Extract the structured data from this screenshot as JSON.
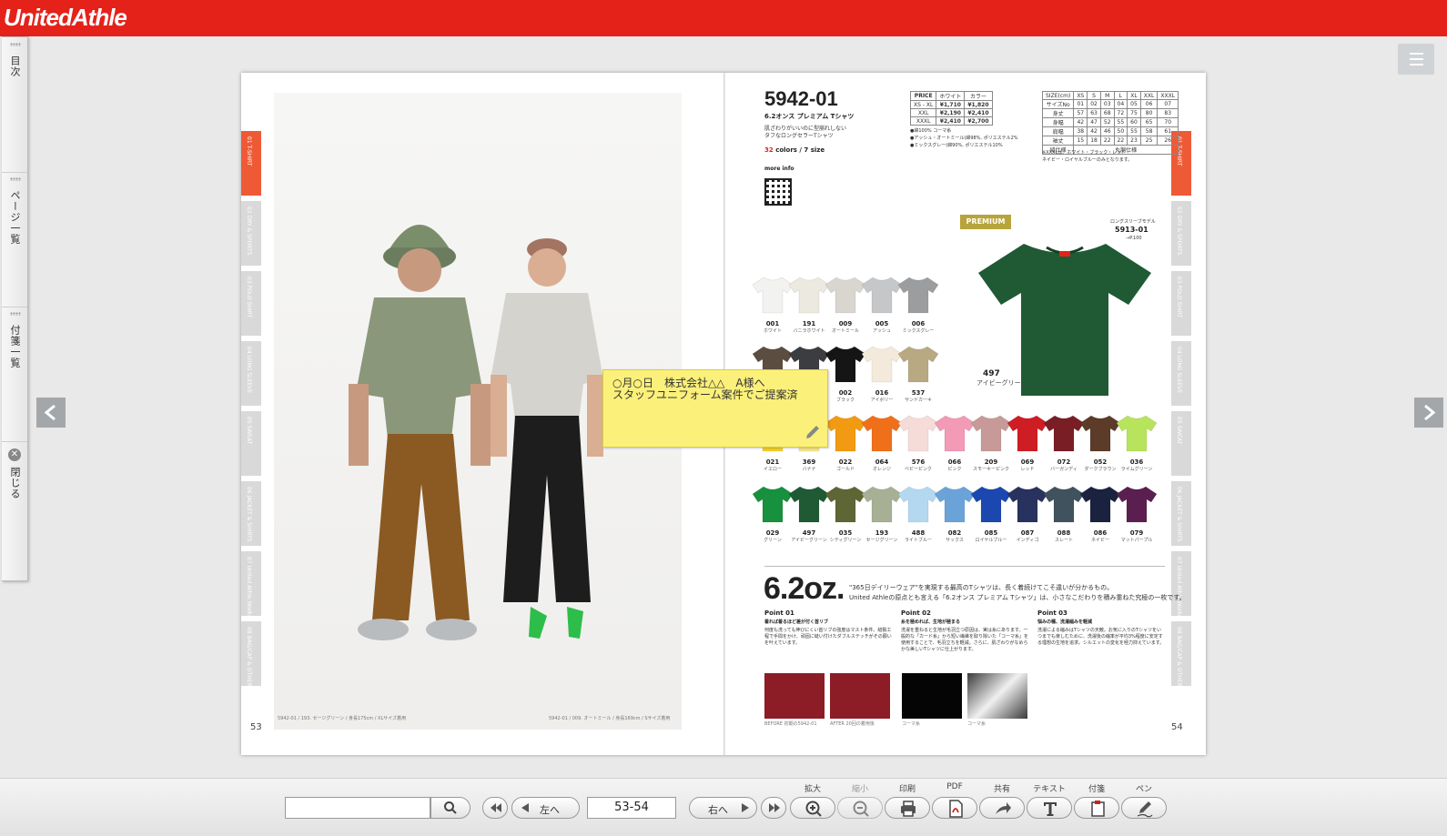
{
  "app": {
    "logo": "UnitedAthle"
  },
  "sidebar": {
    "items": [
      {
        "label": "目次"
      },
      {
        "label": "ページ一覧"
      },
      {
        "label": "付箋一覧"
      },
      {
        "label": "閉じる"
      }
    ]
  },
  "book": {
    "left_page": {
      "number": "53",
      "caption_left": "5942-01 / 193. セージグリーン / 身長175cm / XLサイズ着用",
      "caption_right": "5942-01 / 009. オートミール / 身長169cm / Sサイズ着用",
      "tabs": [
        "01 T-SHIRT",
        "02 DRY & SPORTS",
        "03 POLO SHIRT",
        "04 LONG SLEEVE",
        "05 SWEAT",
        "06 JACKET & SHIRTS",
        "07 United Athle Works",
        "08 BAG/CAP & OTHER"
      ]
    },
    "right_page": {
      "number": "54",
      "product_code": "5942-01",
      "product_name": "6.2オンス プレミアム Tシャツ",
      "desc_1": "肌ざわりがいいのに型崩れしない",
      "desc_2": "タフなロングセラーTシャツ",
      "colors_count": "32",
      "colors_suffix": "colors / 7 size",
      "more_info": "more info",
      "material_1": "●綿100% コーマ糸",
      "material_2": "●アッシュ・オートミール(綿98%, ポリエステル2%",
      "material_3": "●ミックスグレー(綿90%, ポリエステル10%",
      "premium_badge": "PREMIUM",
      "related_label": "ロングスリーブモデル",
      "related_code": "5913-01",
      "related_page": "→P.100",
      "size_note_1": "※XXXLは、ホワイト・ブラック・レッド・",
      "size_note_2": "ネイビー・ロイヤルブルーのみとなります。",
      "featured": {
        "code": "497",
        "name": "アイビーグリーン"
      },
      "price_table": {
        "header": [
          "PRICE",
          "ホワイト",
          "カラー"
        ],
        "rows": [
          [
            "XS - XL",
            "¥1,710",
            "¥1,820"
          ],
          [
            "XXL",
            "¥2,190",
            "¥2,410"
          ],
          [
            "XXXL",
            "¥2,410",
            "¥2,700"
          ]
        ]
      },
      "size_table": {
        "header": [
          "SIZE(cm)",
          "XS",
          "S",
          "M",
          "L",
          "XL",
          "XXL",
          "XXXL"
        ],
        "rows": [
          [
            "サイズNo",
            "01",
            "02",
            "03",
            "04",
            "05",
            "06",
            "07"
          ],
          [
            "身丈",
            "57",
            "63",
            "68",
            "72",
            "75",
            "80",
            "83"
          ],
          [
            "身幅",
            "42",
            "47",
            "52",
            "55",
            "60",
            "65",
            "70"
          ],
          [
            "肩幅",
            "38",
            "42",
            "46",
            "50",
            "55",
            "58",
            "61"
          ],
          [
            "袖丈",
            "15",
            "18",
            "22",
            "22",
            "23",
            "25",
            "26"
          ],
          [
            "縫仕様",
            "",
            "",
            "",
            "丸胴仕様",
            "",
            "",
            ""
          ]
        ]
      },
      "swatches_row1": [
        {
          "code": "001",
          "name": "ホワイト",
          "color": "#f2f2f0"
        },
        {
          "code": "191",
          "name": "バニラホワイト",
          "color": "#ece9e0"
        },
        {
          "code": "009",
          "name": "オートミール",
          "color": "#d9d6cf"
        },
        {
          "code": "005",
          "name": "アッシュ",
          "color": "#c5c7c9"
        },
        {
          "code": "006",
          "name": "ミックスグレー",
          "color": "#9c9d9f"
        }
      ],
      "swatches_row2": [
        {
          "code": "",
          "name": "",
          "color": "#5b4d40"
        },
        {
          "code": "",
          "name": "",
          "color": "#3c3d40"
        },
        {
          "code": "002",
          "name": "ブラック",
          "color": "#151515"
        },
        {
          "code": "016",
          "name": "アイボリー",
          "color": "#f3eadb"
        },
        {
          "code": "537",
          "name": "サンドカーキ",
          "color": "#b9a983"
        }
      ],
      "swatches_row3": [
        {
          "code": "021",
          "name": "イエロー",
          "color": "#f6d02a"
        },
        {
          "code": "369",
          "name": "バナナ",
          "color": "#f8e68c"
        },
        {
          "code": "022",
          "name": "ゴールド",
          "color": "#f29a12"
        },
        {
          "code": "064",
          "name": "オレンジ",
          "color": "#f0701a"
        },
        {
          "code": "576",
          "name": "ベビーピンク",
          "color": "#f5dcd9"
        },
        {
          "code": "066",
          "name": "ピンク",
          "color": "#f29ab6"
        },
        {
          "code": "209",
          "name": "スモーキーピンク",
          "color": "#c79a98"
        },
        {
          "code": "069",
          "name": "レッド",
          "color": "#cf1d24"
        },
        {
          "code": "072",
          "name": "バーガンディ",
          "color": "#7a1e26"
        },
        {
          "code": "052",
          "name": "ダークブラウン",
          "color": "#5c3b28"
        },
        {
          "code": "036",
          "name": "ライムグリーン",
          "color": "#b7e45c"
        }
      ],
      "swatches_row4": [
        {
          "code": "029",
          "name": "グリーン",
          "color": "#17913d"
        },
        {
          "code": "497",
          "name": "アイビーグリーン",
          "color": "#1f5a34"
        },
        {
          "code": "035",
          "name": "シティグリーン",
          "color": "#5e6635"
        },
        {
          "code": "193",
          "name": "セージグリーン",
          "color": "#a7b095"
        },
        {
          "code": "488",
          "name": "ライトブルー",
          "color": "#b4d8f0"
        },
        {
          "code": "082",
          "name": "サックス",
          "color": "#6aa3d8"
        },
        {
          "code": "085",
          "name": "ロイヤルブルー",
          "color": "#1d47b0"
        },
        {
          "code": "087",
          "name": "インディゴ",
          "color": "#27325f"
        },
        {
          "code": "088",
          "name": "スレート",
          "color": "#3f525e"
        },
        {
          "code": "086",
          "name": "ネイビー",
          "color": "#1b2240"
        },
        {
          "code": "079",
          "name": "マットパープル",
          "color": "#5b1f4f"
        }
      ],
      "oz": "6.2oz.",
      "oz_line1": "\"365日デイリーウェア\"を実現する最高のTシャツは、長く着続けてこそ違いが分かるもの。",
      "oz_line2": "United Athleの原点とも言える「6.2オンス プレミアム Tシャツ」は、小さなこだわりを積み重ねた究極の一枚です。",
      "points": [
        {
          "title": "Point 01",
          "sub": "着れば着るほど差が付く首リブ",
          "text": "何度も洗っても伸びにくい首リブの強度はマスト条件。縫製工程で手間をかけ、頑固に縫い付けたダブルステッチがその願いを叶えています。"
        },
        {
          "title": "Point 02",
          "sub": "糸を極めれば、生地が極まる",
          "text": "洗濯を重ねると生地が毛羽立つ原因は、実は糸にあります。一般的な「カード糸」から短い繊維を取り除いた「コーマ糸」を使用することで、毛羽立ちを軽減。さらに、肌ざわりがなめらかな美しいTシャツに仕上がります。"
        },
        {
          "title": "Point 03",
          "sub": "悩みの種、洗濯縮みを軽減",
          "text": "洗濯による縮みはTシャツの天敵。お気に入りのTシャツをいつまでも楽しむために、洗濯後の縮率が平均3%程度に安定する理想の生地を追求。シルエットの変化を極力抑えています。"
        }
      ],
      "thumb_caps": [
        "BEFORE 初期の5942-01",
        "AFTER 20回の着用後",
        "コーマ糸",
        "コーマ糸"
      ],
      "tabs": [
        "01 T-SHIRT",
        "02 DRY & SPORTS",
        "03 POLO SHIRT",
        "04 LONG SLEEVE",
        "05 SWEAT",
        "06 JACKET & SHIRTS",
        "07 United Athle Works",
        "08 BAG/CAP & OTHER"
      ]
    }
  },
  "sticky_note": {
    "text": "○月○日　株式会社△△　A様へ\nスタッフユニフォーム案件でご提案済"
  },
  "toolbar": {
    "search_placeholder": "",
    "prev_label": "左へ",
    "page_value": "53-54",
    "next_label": "右へ",
    "tools": [
      {
        "label": "拡大",
        "icon": "zoom-in-icon"
      },
      {
        "label": "縮小",
        "icon": "zoom-out-icon"
      },
      {
        "label": "印刷",
        "icon": "print-icon"
      },
      {
        "label": "PDF",
        "icon": "pdf-icon"
      },
      {
        "label": "共有",
        "icon": "share-icon"
      },
      {
        "label": "テキスト",
        "icon": "text-icon"
      },
      {
        "label": "付箋",
        "icon": "sticky-note-icon"
      },
      {
        "label": "ペン",
        "icon": "pen-icon"
      }
    ]
  },
  "colors": {
    "brand": "#e4221a",
    "tab_active": "#ef5a36",
    "note": "#fbf07a"
  }
}
